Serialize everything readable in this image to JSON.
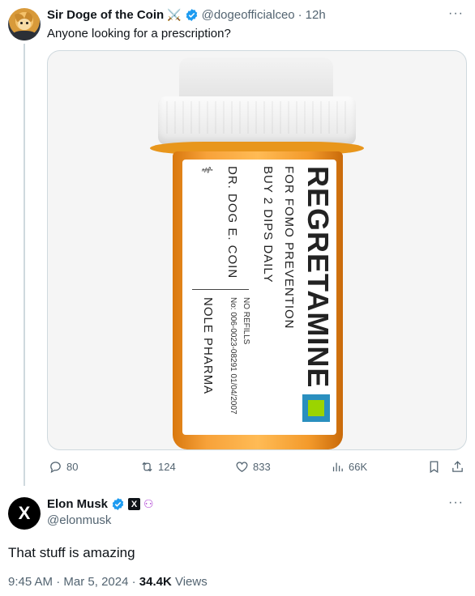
{
  "tweet1": {
    "display_name": "Sir Doge of the Coin",
    "name_emoji": "⚔️",
    "handle": "@dogeofficialceo",
    "separator": "·",
    "time": "12h",
    "more": "···",
    "text": "Anyone looking for a prescription?",
    "image": {
      "drug_name": "REGRETAMINE",
      "line1": "FOR FOMO PREVENTION",
      "line2": "BUY 2 DIPS DAILY",
      "doctor": "DR. DOG E. COIN",
      "pharmacy": "NOLE PHARMA",
      "rx_number": "No: 006-0023-08291   01/04/2007",
      "refills": "NO REFILLS"
    },
    "actions": {
      "replies": "80",
      "reposts": "124",
      "likes": "833",
      "views": "66K"
    }
  },
  "tweet2": {
    "avatar_letter": "X",
    "display_name": "Elon Musk",
    "handle": "@elonmusk",
    "more": "···",
    "text": "That stuff is amazing",
    "time": "9:45 AM",
    "date": "Mar 5, 2024",
    "dot": "·",
    "views_count": "34.4K",
    "views_label": "Views"
  },
  "colors": {
    "text_primary": "#0f1419",
    "text_secondary": "#536471",
    "verified_blue": "#1d9bf0",
    "thread_line": "#cfd9de",
    "bottle_orange": "#f7a23a"
  }
}
